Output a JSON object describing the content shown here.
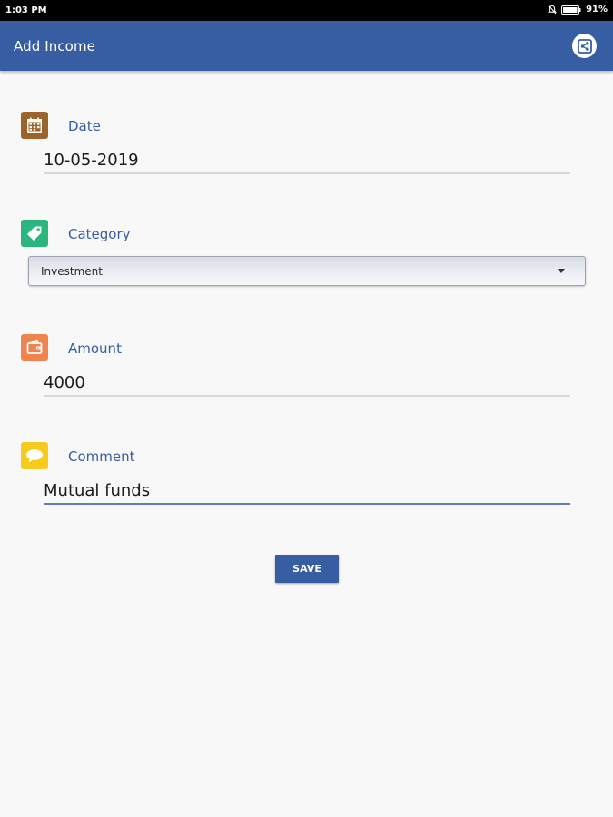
{
  "status_bar": {
    "time": "1:03 PM",
    "battery": "91%"
  },
  "app_bar": {
    "title": "Add Income",
    "action_icon": "share-icon"
  },
  "form": {
    "date": {
      "label": "Date",
      "value": "10-05-2019",
      "icon": "calendar-icon",
      "icon_color": "#9c642b"
    },
    "category": {
      "label": "Category",
      "selected": "Investment",
      "icon": "tag-icon",
      "icon_color": "#2bb680"
    },
    "amount": {
      "label": "Amount",
      "value": "4000",
      "icon": "wallet-icon",
      "icon_color": "#f0834e"
    },
    "comment": {
      "label": "Comment",
      "value": "Mutual funds",
      "icon": "speech-bubble-icon",
      "icon_color": "#f6cb1c"
    }
  },
  "actions": {
    "save_label": "SAVE"
  },
  "colors": {
    "primary": "#375ea3",
    "background": "#f8f8f8"
  }
}
